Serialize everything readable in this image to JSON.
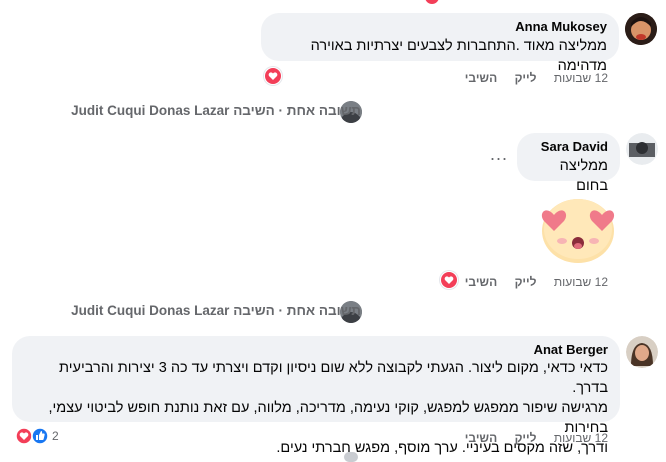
{
  "comments": [
    {
      "author": "Anna Mukosey",
      "text": "ממליצה מאוד .התחברות לצבעים יצרתיות באוירה מדהימה",
      "time": "12 שבועות",
      "like": "לייק",
      "reply": "השיבי"
    },
    {
      "reply_header_action": "השיבה",
      "reply_header_name": "Judit Cuqui Donas Lazar",
      "reply_header_count": "תשובה אחת"
    },
    {
      "author": "Sara David",
      "text": "ממליצה בחום",
      "more": "...",
      "time": "12 שבועות",
      "like": "לייק",
      "reply": "השיבי"
    },
    {
      "reply_header_action": "השיבה",
      "reply_header_name": "Judit Cuqui Donas Lazar",
      "reply_header_count": "תשובה אחת"
    },
    {
      "author": "Anat Berger",
      "text_lines": [
        "כדאי כדאי, מקום ליצור. הגעתי לקבוצה ללא שום ניסיון וקדם ויצרתי עד כה 3 יצירות והרביעית בדרך.",
        "מרגישה שיפור ממפגש למפגש, קוקי נעימה, מדריכה, מלווה, עם זאת נותנת חופש לביטוי עצמי, בחירות",
        "ודרך, שזה מקסים בעיניי. ערך מוסף, מפגש חברתי נעים."
      ],
      "time": "12 שבועות",
      "like": "לייק",
      "reply": "השיבי",
      "reaction_count": "2"
    }
  ],
  "colors": {
    "bubble": "#f0f2f5",
    "meta": "#65676b",
    "heart": "#f33e58",
    "like_blue": "#1877f2"
  },
  "icons": [
    "heart-reaction-icon",
    "like-reaction-icon",
    "heart-eyes-emoji"
  ]
}
